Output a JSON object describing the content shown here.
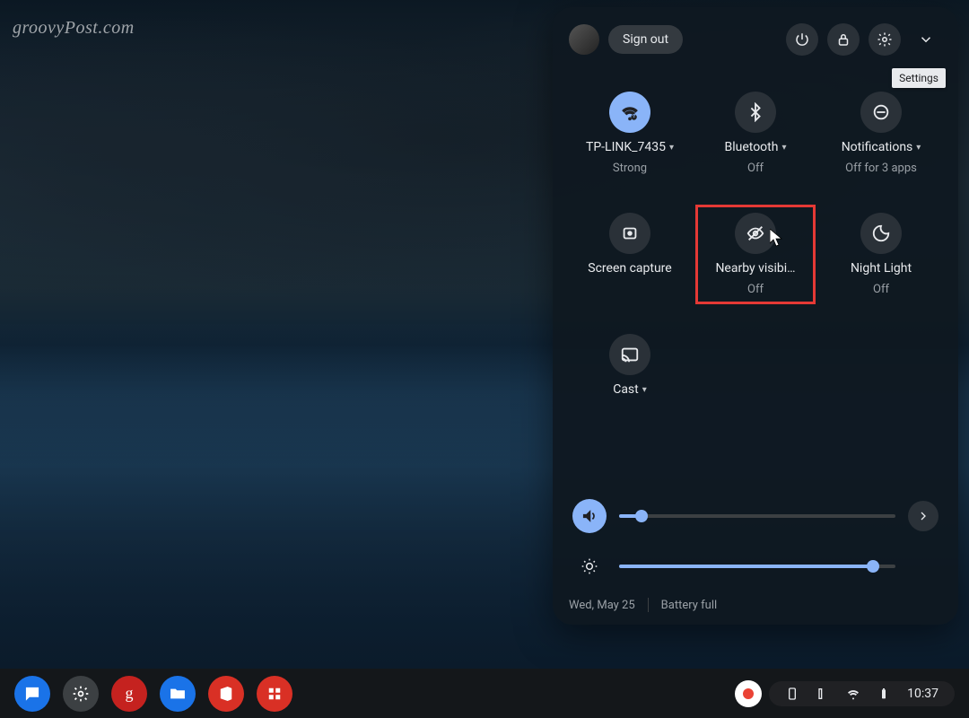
{
  "watermark": "groovyPost.com",
  "header": {
    "signout": "Sign out",
    "tooltip": "Settings"
  },
  "tiles": {
    "wifi": {
      "label": "TP-LINK_7435",
      "sub": "Strong",
      "has_menu": true,
      "on": true
    },
    "bluetooth": {
      "label": "Bluetooth",
      "sub": "Off",
      "has_menu": true,
      "on": false
    },
    "notifications": {
      "label": "Notifications",
      "sub": "Off for 3 apps",
      "has_menu": true,
      "on": false
    },
    "screencapture": {
      "label": "Screen capture",
      "sub": "",
      "has_menu": false,
      "on": false
    },
    "nearby": {
      "label": "Nearby visibi…",
      "sub": "Off",
      "has_menu": false,
      "on": false
    },
    "nightlight": {
      "label": "Night Light",
      "sub": "Off",
      "has_menu": false,
      "on": false
    },
    "cast": {
      "label": "Cast",
      "sub": "",
      "has_menu": true,
      "on": false
    }
  },
  "sliders": {
    "volume_pct": 8,
    "brightness_pct": 92
  },
  "footer": {
    "date": "Wed, May 25",
    "battery": "Battery full"
  },
  "shelf": {
    "clock": "10:37"
  }
}
